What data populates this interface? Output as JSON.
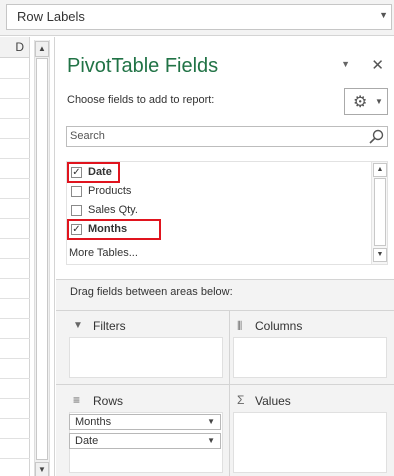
{
  "namebox": {
    "value": "Row Labels"
  },
  "sheet": {
    "column_header": "D"
  },
  "pane": {
    "title": "PivotTable Fields",
    "subtitle": "Choose fields to add to report:",
    "search_placeholder": "Search",
    "fields": [
      {
        "label": "Date",
        "checked": true,
        "bold": true,
        "highlighted": true
      },
      {
        "label": "Products",
        "checked": false,
        "bold": false,
        "highlighted": false
      },
      {
        "label": "Sales Qty.",
        "checked": false,
        "bold": false,
        "highlighted": false
      },
      {
        "label": "Months",
        "checked": true,
        "bold": true,
        "highlighted": true
      }
    ],
    "more_tables": "More Tables...",
    "drag_hint": "Drag fields between areas below:",
    "areas": {
      "filters": {
        "label": "Filters"
      },
      "columns": {
        "label": "Columns"
      },
      "rows": {
        "label": "Rows",
        "items": [
          "Months",
          "Date"
        ]
      },
      "values": {
        "label": "Values"
      }
    }
  },
  "glyphs": {
    "check": "✓",
    "close": "✕",
    "gear": "⚙",
    "caret": "▼",
    "up": "▲",
    "filter": "▼",
    "columns": "⦀",
    "rows": "≡",
    "sigma": "Σ"
  },
  "colors": {
    "title_green": "#217346",
    "highlight_red": "#e0141e"
  }
}
